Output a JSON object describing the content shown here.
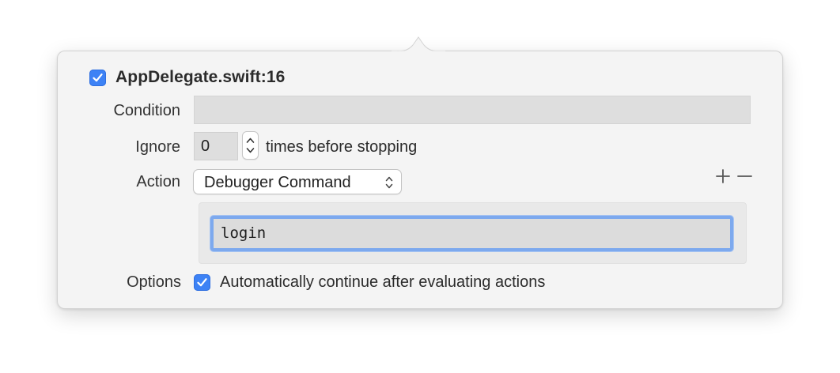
{
  "breakpoint": {
    "enabled": true,
    "title": "AppDelegate.swift:16"
  },
  "condition": {
    "label": "Condition",
    "value": ""
  },
  "ignore": {
    "label": "Ignore",
    "value": "0",
    "suffix": "times before stopping"
  },
  "action": {
    "label": "Action",
    "type": "Debugger Command",
    "add_icon": "plus-icon",
    "remove_icon": "minus-icon",
    "command": "login"
  },
  "options": {
    "label": "Options",
    "auto_continue_checked": true,
    "auto_continue_label": "Automatically continue after evaluating actions"
  },
  "colors": {
    "accent": "#3d82f5",
    "focus_ring": "#7da9ee",
    "popover_bg": "#f4f4f4"
  }
}
